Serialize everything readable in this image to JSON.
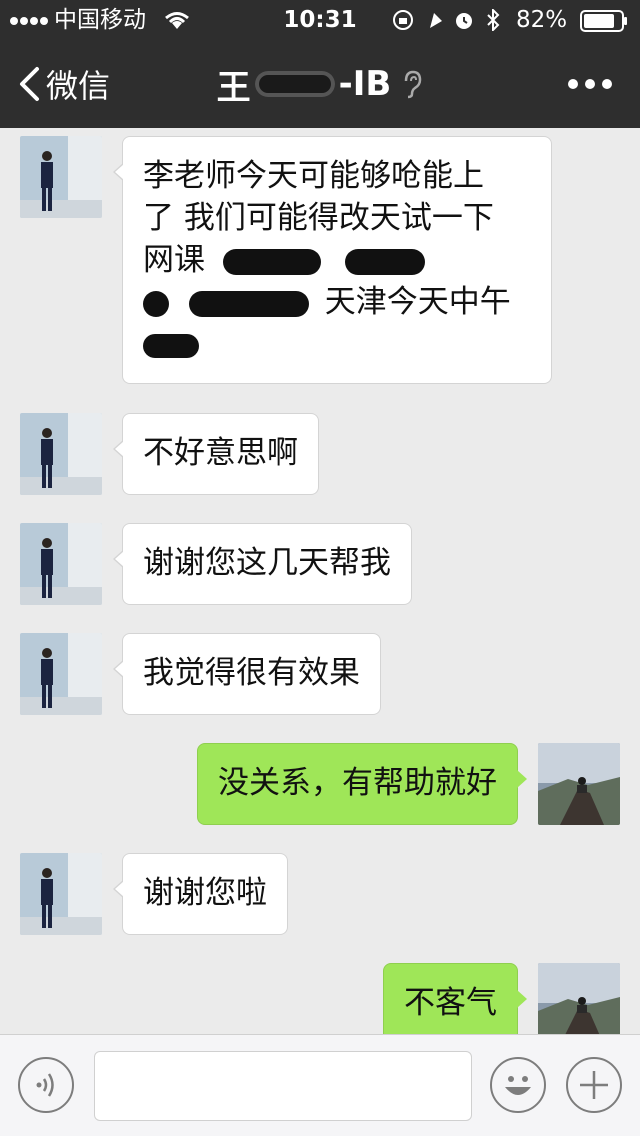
{
  "status_bar": {
    "carrier": "中国移动",
    "time": "10:31",
    "battery": "82%"
  },
  "nav": {
    "back_label": "微信",
    "title_prefix": "王",
    "title_suffix": "-IB"
  },
  "messages": [
    {
      "sender": "contact",
      "lines": [
        "李老师今天可能够呛能上",
        "了 我们可能得改天试一下",
        "网课",
        "天津今天中午"
      ]
    },
    {
      "sender": "contact",
      "text": "不好意思啊"
    },
    {
      "sender": "contact",
      "text": "谢谢您这几天帮我"
    },
    {
      "sender": "contact",
      "text": "我觉得很有效果"
    },
    {
      "sender": "me",
      "text": "没关系，有帮助就好"
    },
    {
      "sender": "contact",
      "text": "谢谢您啦"
    },
    {
      "sender": "me",
      "text": "不客气"
    }
  ],
  "input_bar": {
    "voice_icon": "voice-icon",
    "emoji_icon": "emoji-icon",
    "plus_icon": "plus-icon",
    "message_value": ""
  },
  "colors": {
    "header_bg": "#2e2e2e",
    "chat_bg": "#ebebeb",
    "outgoing_bubble": "#9fe658",
    "incoming_bubble": "#ffffff"
  }
}
